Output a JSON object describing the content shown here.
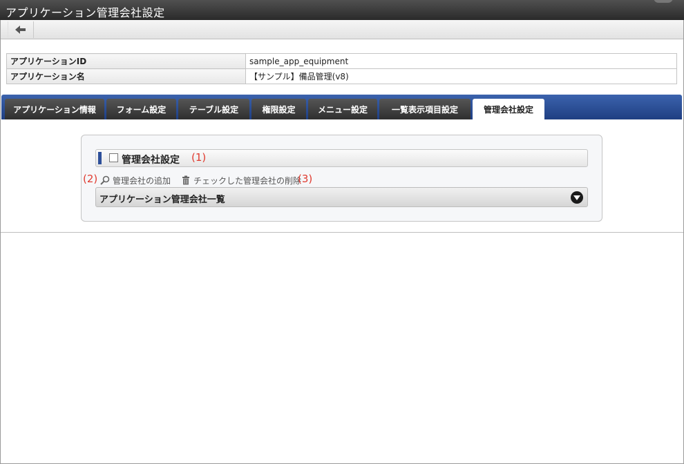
{
  "window": {
    "title": "アプリケーション管理会社設定"
  },
  "toolbar": {
    "back_icon": "back-arrow-icon"
  },
  "info": {
    "rows": [
      {
        "label": "アプリケーションID",
        "value": "sample_app_equipment"
      },
      {
        "label": "アプリケーション名",
        "value": "【サンプル】備品管理(v8)"
      }
    ]
  },
  "tabs": [
    {
      "label": "アプリケーション情報",
      "active": false
    },
    {
      "label": "フォーム設定",
      "active": false
    },
    {
      "label": "テーブル設定",
      "active": false
    },
    {
      "label": "権限設定",
      "active": false
    },
    {
      "label": "メニュー設定",
      "active": false
    },
    {
      "label": "一覧表示項目設定",
      "active": false
    },
    {
      "label": "管理会社設定",
      "active": true
    }
  ],
  "section": {
    "title": "管理会社設定",
    "annotation": "(1)",
    "checked": false
  },
  "actions": {
    "add_annotation": "(2)",
    "add_label": "管理会社の追加",
    "add_icon": "search-icon",
    "delete_label": "チェックした管理会社の削除",
    "delete_icon": "trash-icon",
    "delete_annotation": "(3)"
  },
  "list": {
    "title": "アプリケーション管理会社一覧",
    "toggle_icon": "chevron-down-circle-icon"
  },
  "colors": {
    "tab_bar": "#2a4f97",
    "annotation": "#e03a2f",
    "titlebar": "#3a3a3a"
  }
}
